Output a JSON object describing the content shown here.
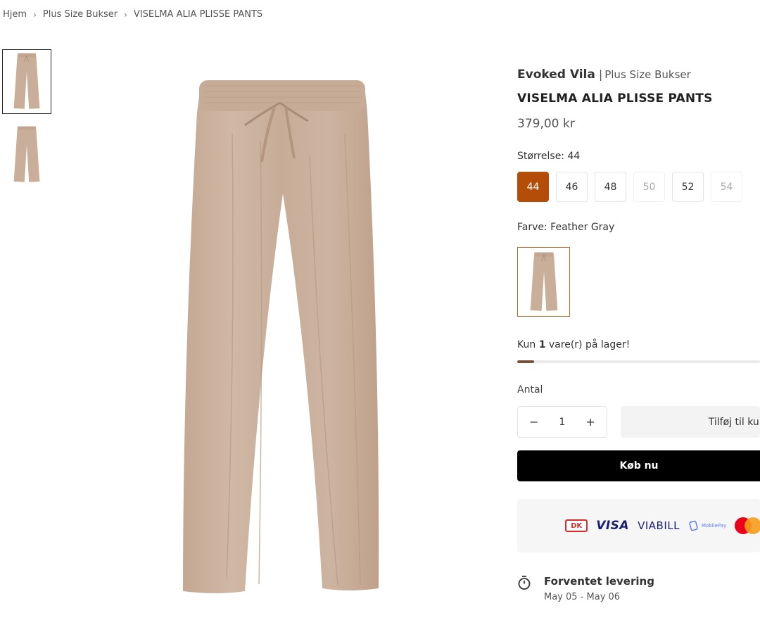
{
  "breadcrumb": {
    "home": "Hjem",
    "category": "Plus Size Bukser",
    "current": "VISELMA ALIA PLISSE PANTS"
  },
  "product": {
    "brand": "Evoked Vila",
    "category": "Plus Size Bukser",
    "title": "VISELMA ALIA PLISSE PANTS",
    "price": "379,00 kr",
    "image_color": "#c9af9a"
  },
  "size": {
    "label": "Størrelse: 44",
    "options": [
      {
        "label": "44",
        "state": "selected"
      },
      {
        "label": "46",
        "state": "available"
      },
      {
        "label": "48",
        "state": "available"
      },
      {
        "label": "50",
        "state": "unavailable"
      },
      {
        "label": "52",
        "state": "available"
      },
      {
        "label": "54",
        "state": "unavailable"
      }
    ],
    "selected_color": "#b34d08"
  },
  "color": {
    "label": "Farve: Feather Gray"
  },
  "stock": {
    "prefix": "Kun ",
    "count": "1",
    "suffix": " vare(r) på lager!",
    "level": 0.07,
    "bar_color": "#7a4f3a"
  },
  "quantity": {
    "label": "Antal",
    "minus": "−",
    "value": "1",
    "plus": "+"
  },
  "buttons": {
    "add_to_cart": "Tilføj til kurv",
    "buy_now": "Køb nu"
  },
  "payments": {
    "dk": "DK",
    "visa": "VISA",
    "viabill": "VIABILL",
    "mobilepay": "MobilePay"
  },
  "delivery": {
    "title": "Forventet levering",
    "dates": "May 05 - May 06"
  }
}
